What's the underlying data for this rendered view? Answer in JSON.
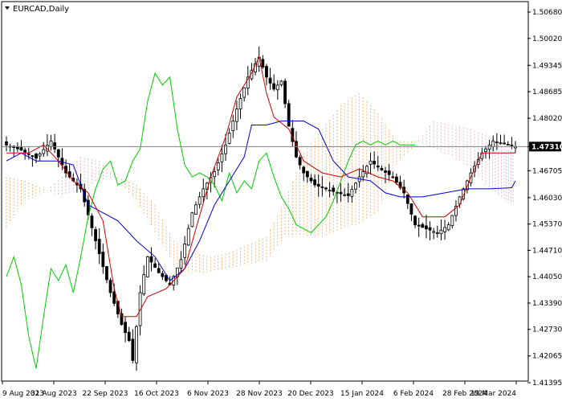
{
  "window": {
    "title": "EURCAD,Daily",
    "dropdown_icon": "triangle-down-icon"
  },
  "chart_data": {
    "type": "candlestick",
    "symbol": "EURCAD",
    "timeframe": "Daily",
    "x_labels": [
      "9 Aug 2023",
      "31 Aug 2023",
      "22 Sep 2023",
      "16 Oct 2023",
      "6 Nov 2023",
      "28 Nov 2023",
      "20 Dec 2023",
      "15 Jan 2024",
      "6 Feb 2024",
      "28 Feb 2024",
      "19 Mar 2024"
    ],
    "y_ticks": [
      "1.50680",
      "1.50020",
      "1.49345",
      "1.48685",
      "1.48020",
      "1.47310",
      "1.46705",
      "1.46030",
      "1.45370",
      "1.44710",
      "1.44050",
      "1.43390",
      "1.42730",
      "1.42065",
      "1.41395"
    ],
    "ylim": [
      1.41395,
      1.5068
    ],
    "current_price": "1.47310",
    "current_price_value": 1.4731,
    "grid": false,
    "close_anchors": [
      {
        "i": 0,
        "v": 1.4735
      },
      {
        "i": 4,
        "v": 1.4722
      },
      {
        "i": 8,
        "v": 1.4702
      },
      {
        "i": 12,
        "v": 1.4745
      },
      {
        "i": 16,
        "v": 1.4665
      },
      {
        "i": 20,
        "v": 1.4625
      },
      {
        "i": 24,
        "v": 1.4495
      },
      {
        "i": 28,
        "v": 1.4365
      },
      {
        "i": 31,
        "v": 1.4285
      },
      {
        "i": 33,
        "v": 1.4245
      },
      {
        "i": 34,
        "v": 1.4195
      },
      {
        "i": 36,
        "v": 1.4365
      },
      {
        "i": 38,
        "v": 1.4455
      },
      {
        "i": 41,
        "v": 1.4415
      },
      {
        "i": 44,
        "v": 1.4385
      },
      {
        "i": 47,
        "v": 1.4448
      },
      {
        "i": 50,
        "v": 1.4565
      },
      {
        "i": 53,
        "v": 1.4625
      },
      {
        "i": 56,
        "v": 1.4668
      },
      {
        "i": 59,
        "v": 1.4735
      },
      {
        "i": 62,
        "v": 1.4825
      },
      {
        "i": 65,
        "v": 1.4905
      },
      {
        "i": 68,
        "v": 1.4955
      },
      {
        "i": 70,
        "v": 1.4905
      },
      {
        "i": 72,
        "v": 1.4875
      },
      {
        "i": 74,
        "v": 1.4895
      },
      {
        "i": 76,
        "v": 1.4782
      },
      {
        "i": 78,
        "v": 1.4705
      },
      {
        "i": 80,
        "v": 1.4665
      },
      {
        "i": 83,
        "v": 1.4635
      },
      {
        "i": 86,
        "v": 1.4625
      },
      {
        "i": 89,
        "v": 1.4615
      },
      {
        "i": 92,
        "v": 1.4608
      },
      {
        "i": 95,
        "v": 1.4655
      },
      {
        "i": 98,
        "v": 1.4695
      },
      {
        "i": 101,
        "v": 1.4672
      },
      {
        "i": 104,
        "v": 1.4655
      },
      {
        "i": 107,
        "v": 1.4615
      },
      {
        "i": 110,
        "v": 1.4535
      },
      {
        "i": 113,
        "v": 1.4525
      },
      {
        "i": 116,
        "v": 1.4515
      },
      {
        "i": 119,
        "v": 1.4535
      },
      {
        "i": 122,
        "v": 1.4605
      },
      {
        "i": 125,
        "v": 1.4665
      },
      {
        "i": 128,
        "v": 1.4715
      },
      {
        "i": 131,
        "v": 1.4745
      },
      {
        "i": 134,
        "v": 1.4738
      },
      {
        "i": 137,
        "v": 1.4731
      }
    ],
    "ichimoku": {
      "tenkan_sen": [
        [
          0,
          1.4715
        ],
        [
          6,
          1.4715
        ],
        [
          10,
          1.4735
        ],
        [
          14,
          1.4695
        ],
        [
          18,
          1.4645
        ],
        [
          22,
          1.4615
        ],
        [
          26,
          1.4545
        ],
        [
          29,
          1.4375
        ],
        [
          31,
          1.4305
        ],
        [
          35,
          1.4305
        ],
        [
          38,
          1.4355
        ],
        [
          43,
          1.4375
        ],
        [
          48,
          1.4425
        ],
        [
          51,
          1.4525
        ],
        [
          55,
          1.4655
        ],
        [
          59,
          1.4755
        ],
        [
          62,
          1.4855
        ],
        [
          66,
          1.4915
        ],
        [
          68,
          1.4955
        ],
        [
          70,
          1.4865
        ],
        [
          72,
          1.4805
        ],
        [
          76,
          1.4775
        ],
        [
          80,
          1.4695
        ],
        [
          85,
          1.4665
        ],
        [
          90,
          1.4655
        ],
        [
          95,
          1.4675
        ],
        [
          100,
          1.4655
        ],
        [
          104,
          1.4645
        ],
        [
          108,
          1.4615
        ],
        [
          112,
          1.4555
        ],
        [
          118,
          1.4555
        ],
        [
          122,
          1.4585
        ],
        [
          125,
          1.4655
        ],
        [
          128,
          1.4715
        ],
        [
          133,
          1.4715
        ],
        [
          137,
          1.4715
        ]
      ],
      "kijun_sen": [
        [
          0,
          1.4695
        ],
        [
          4,
          1.4715
        ],
        [
          8,
          1.4695
        ],
        [
          14,
          1.4695
        ],
        [
          18,
          1.4685
        ],
        [
          22,
          1.4585
        ],
        [
          26,
          1.4565
        ],
        [
          30,
          1.4545
        ],
        [
          35,
          1.4495
        ],
        [
          40,
          1.4455
        ],
        [
          44,
          1.4395
        ],
        [
          48,
          1.4425
        ],
        [
          52,
          1.4495
        ],
        [
          56,
          1.4585
        ],
        [
          60,
          1.4645
        ],
        [
          64,
          1.4705
        ],
        [
          66,
          1.4785
        ],
        [
          70,
          1.4785
        ],
        [
          74,
          1.4795
        ],
        [
          80,
          1.4795
        ],
        [
          84,
          1.4775
        ],
        [
          88,
          1.4695
        ],
        [
          92,
          1.4655
        ],
        [
          98,
          1.4645
        ],
        [
          102,
          1.4615
        ],
        [
          106,
          1.4605
        ],
        [
          112,
          1.4605
        ],
        [
          118,
          1.4615
        ],
        [
          124,
          1.4625
        ],
        [
          130,
          1.4625
        ],
        [
          136,
          1.4628
        ],
        [
          137,
          1.4645
        ]
      ],
      "chikou_span": [
        [
          0,
          1.4405
        ],
        [
          2,
          1.4455
        ],
        [
          4,
          1.4385
        ],
        [
          6,
          1.4255
        ],
        [
          8,
          1.4175
        ],
        [
          10,
          1.4305
        ],
        [
          12,
          1.4425
        ],
        [
          14,
          1.4395
        ],
        [
          16,
          1.4435
        ],
        [
          18,
          1.4365
        ],
        [
          20,
          1.4455
        ],
        [
          22,
          1.4555
        ],
        [
          24,
          1.4625
        ],
        [
          26,
          1.4675
        ],
        [
          28,
          1.4695
        ],
        [
          30,
          1.4635
        ],
        [
          32,
          1.4645
        ],
        [
          34,
          1.4695
        ],
        [
          36,
          1.4725
        ],
        [
          38,
          1.4845
        ],
        [
          40,
          1.4915
        ],
        [
          42,
          1.4885
        ],
        [
          44,
          1.4905
        ],
        [
          46,
          1.4775
        ],
        [
          48,
          1.4685
        ],
        [
          50,
          1.4655
        ],
        [
          52,
          1.4665
        ],
        [
          54,
          1.4655
        ],
        [
          56,
          1.4635
        ],
        [
          58,
          1.4595
        ],
        [
          60,
          1.4665
        ],
        [
          62,
          1.4615
        ],
        [
          64,
          1.4645
        ],
        [
          66,
          1.4625
        ],
        [
          68,
          1.4695
        ],
        [
          70,
          1.4715
        ],
        [
          72,
          1.4655
        ],
        [
          74,
          1.4605
        ],
        [
          76,
          1.4575
        ],
        [
          78,
          1.4535
        ],
        [
          80,
          1.4525
        ],
        [
          82,
          1.4515
        ],
        [
          84,
          1.4535
        ],
        [
          86,
          1.4555
        ],
        [
          88,
          1.4595
        ],
        [
          90,
          1.4645
        ],
        [
          92,
          1.4695
        ],
        [
          94,
          1.4735
        ],
        [
          96,
          1.4745
        ],
        [
          98,
          1.4735
        ],
        [
          100,
          1.4745
        ],
        [
          102,
          1.4735
        ],
        [
          104,
          1.4745
        ],
        [
          106,
          1.4735
        ],
        [
          108,
          1.4735
        ],
        [
          110,
          1.4735
        ]
      ],
      "cloud": [
        {
          "x": 0,
          "a": 1.4655,
          "b": 1.4525
        },
        {
          "x": 5,
          "a": 1.4645,
          "b": 1.4595
        },
        {
          "x": 10,
          "a": 1.4625,
          "b": 1.4615
        },
        {
          "x": 15,
          "a": 1.4605,
          "b": 1.4655
        },
        {
          "x": 20,
          "a": 1.4625,
          "b": 1.4705
        },
        {
          "x": 25,
          "a": 1.4645,
          "b": 1.4695
        },
        {
          "x": 30,
          "a": 1.4655,
          "b": 1.4645
        },
        {
          "x": 35,
          "a": 1.4635,
          "b": 1.4595
        },
        {
          "x": 40,
          "a": 1.4585,
          "b": 1.4515
        },
        {
          "x": 45,
          "a": 1.4495,
          "b": 1.4435
        },
        {
          "x": 50,
          "a": 1.4465,
          "b": 1.4415
        },
        {
          "x": 55,
          "a": 1.4455,
          "b": 1.4415
        },
        {
          "x": 60,
          "a": 1.4465,
          "b": 1.4425
        },
        {
          "x": 65,
          "a": 1.4485,
          "b": 1.4435
        },
        {
          "x": 70,
          "a": 1.4505,
          "b": 1.4445
        },
        {
          "x": 75,
          "a": 1.4595,
          "b": 1.4505
        },
        {
          "x": 80,
          "a": 1.4715,
          "b": 1.4505
        },
        {
          "x": 85,
          "a": 1.4775,
          "b": 1.4505
        },
        {
          "x": 90,
          "a": 1.4835,
          "b": 1.4525
        },
        {
          "x": 95,
          "a": 1.4865,
          "b": 1.4535
        },
        {
          "x": 100,
          "a": 1.4815,
          "b": 1.4565
        },
        {
          "x": 105,
          "a": 1.4745,
          "b": 1.4685
        },
        {
          "x": 110,
          "a": 1.4745,
          "b": 1.4735
        },
        {
          "x": 115,
          "a": 1.4725,
          "b": 1.4795
        },
        {
          "x": 120,
          "a": 1.4705,
          "b": 1.4785
        },
        {
          "x": 125,
          "a": 1.4675,
          "b": 1.4775
        },
        {
          "x": 130,
          "a": 1.4625,
          "b": 1.4755
        },
        {
          "x": 134,
          "a": 1.4595,
          "b": 1.4725
        },
        {
          "x": 137,
          "a": 1.4585,
          "b": 1.4715
        }
      ]
    },
    "colors": {
      "up_candle": "#000000",
      "down_candle": "#000000",
      "tenkan": "#cc0000",
      "kijun": "#0000cc",
      "chikou": "#00cc00",
      "cloud_up": "#f4a460",
      "cloud_down": "#d8a8c8",
      "price_label_bg": "#000000",
      "price_line": "#808080",
      "frame": "#000000",
      "background": "#ffffff"
    }
  }
}
